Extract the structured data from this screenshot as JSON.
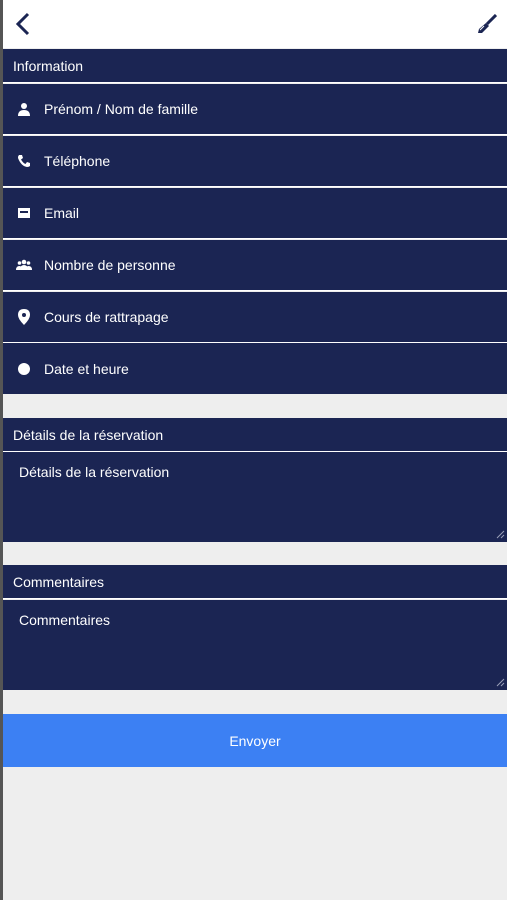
{
  "header": {
    "back_icon": "chevron-left-icon",
    "brush_icon": "paint-brush-icon"
  },
  "information": {
    "title": "Information",
    "fields": [
      {
        "label": "Prénom / Nom de famille",
        "icon": "person-icon"
      },
      {
        "label": "Téléphone",
        "icon": "phone-icon"
      },
      {
        "label": "Email",
        "icon": "email-icon"
      },
      {
        "label": "Nombre de personne",
        "icon": "group-icon"
      },
      {
        "label": "Cours de rattrapage",
        "icon": "map-pin-icon"
      },
      {
        "label": "Date et heure",
        "icon": "dot-icon"
      }
    ]
  },
  "details": {
    "title": "Détails de la réservation",
    "placeholder": "Détails de la réservation"
  },
  "comments": {
    "title": "Commentaires",
    "placeholder": "Commentaires"
  },
  "submit": {
    "label": "Envoyer"
  },
  "colors": {
    "panel": "#1b2553",
    "button": "#3c80f3",
    "background": "#eeeeee"
  }
}
